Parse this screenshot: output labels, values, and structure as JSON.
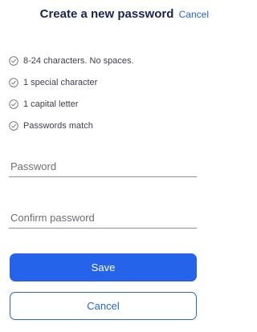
{
  "header": {
    "title": "Create a new password",
    "cancel_label": "Cancel"
  },
  "requirements": [
    {
      "label": "8-24 characters. No spaces.",
      "icon": "check-circle-icon"
    },
    {
      "label": "1 special character",
      "icon": "check-circle-icon"
    },
    {
      "label": "1 capital letter",
      "icon": "check-circle-icon"
    },
    {
      "label": "Passwords match",
      "icon": "check-circle-icon"
    }
  ],
  "form": {
    "password_placeholder": "Password",
    "password_value": "",
    "confirm_placeholder": "Confirm password",
    "confirm_value": ""
  },
  "actions": {
    "save_label": "Save",
    "cancel_label": "Cancel"
  },
  "colors": {
    "accent": "#2563eb",
    "title": "#1a2552",
    "text": "#3a3f4b",
    "icon": "#6b6f7a"
  }
}
